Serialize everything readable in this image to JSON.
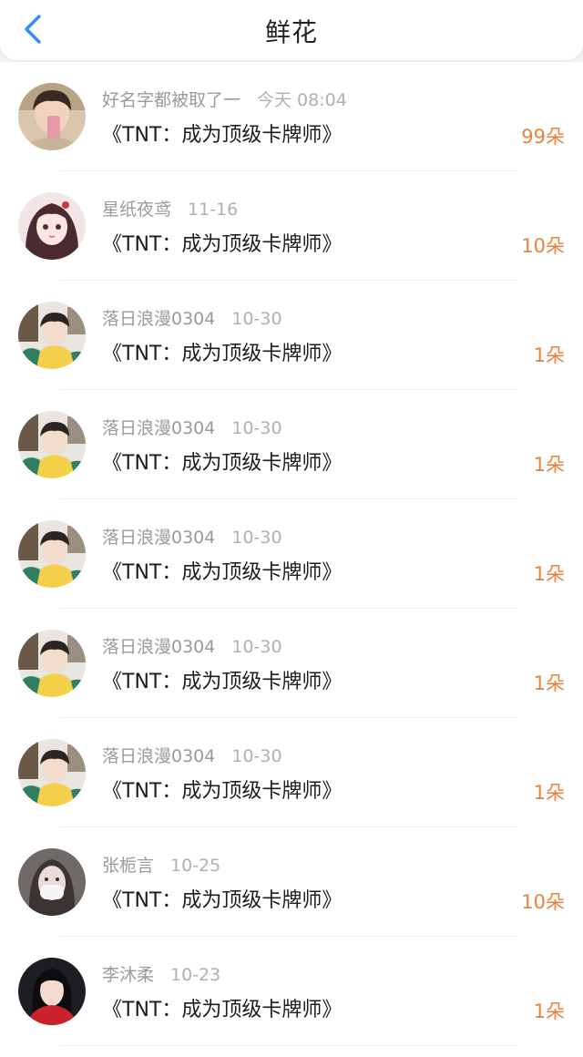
{
  "header": {
    "title": "鲜花"
  },
  "colors": {
    "accent_orange": "#e8823a",
    "back_blue": "#2f8cf0"
  },
  "rows": [
    {
      "user": "好名字都被取了一",
      "date": "今天 08:04",
      "book": "《TNT：成为顶级卡牌师》",
      "count": "99朵",
      "avatar": "avatar-boy-selfie"
    },
    {
      "user": "星纸夜鸢",
      "date": "11-16",
      "book": "《TNT：成为顶级卡牌师》",
      "count": "10朵",
      "avatar": "avatar-girl-anime"
    },
    {
      "user": "落日浪漫0304",
      "date": "10-30",
      "book": "《TNT：成为顶级卡牌师》",
      "count": "1朵",
      "avatar": "avatar-boy-yellow"
    },
    {
      "user": "落日浪漫0304",
      "date": "10-30",
      "book": "《TNT：成为顶级卡牌师》",
      "count": "1朵",
      "avatar": "avatar-boy-yellow"
    },
    {
      "user": "落日浪漫0304",
      "date": "10-30",
      "book": "《TNT：成为顶级卡牌师》",
      "count": "1朵",
      "avatar": "avatar-boy-yellow"
    },
    {
      "user": "落日浪漫0304",
      "date": "10-30",
      "book": "《TNT：成为顶级卡牌师》",
      "count": "1朵",
      "avatar": "avatar-boy-yellow"
    },
    {
      "user": "落日浪漫0304",
      "date": "10-30",
      "book": "《TNT：成为顶级卡牌师》",
      "count": "1朵",
      "avatar": "avatar-boy-yellow"
    },
    {
      "user": "张栀言",
      "date": "10-25",
      "book": "《TNT：成为顶级卡牌师》",
      "count": "10朵",
      "avatar": "avatar-girl-mask"
    },
    {
      "user": "李沐柔",
      "date": "10-23",
      "book": "《TNT：成为顶级卡牌师》",
      "count": "1朵",
      "avatar": "avatar-girl-red"
    }
  ]
}
